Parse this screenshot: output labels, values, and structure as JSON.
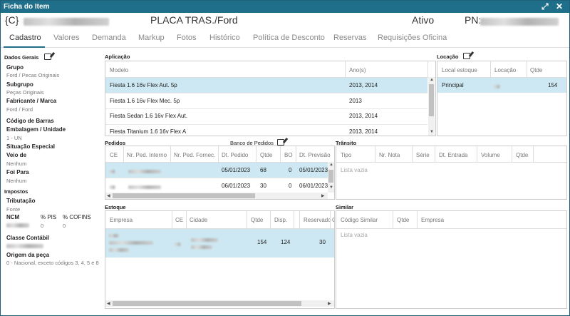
{
  "window": {
    "title": "Ficha do Item",
    "expand_icon": "expand-icon",
    "close_icon": "close-icon"
  },
  "header": {
    "code": "{C}",
    "description": "PLACA TRAS./Ford",
    "status": "Ativo",
    "pn_label": "PN:"
  },
  "tabs": [
    "Cadastro",
    "Valores",
    "Demanda",
    "Markup",
    "Fotos",
    "Histórico",
    "Política de Desconto",
    "Reservas",
    "Requisições Oficina"
  ],
  "side": {
    "title": "Dados Gerais",
    "grupo_label": "Grupo",
    "grupo_value": "Ford / Pecas Originais",
    "subgrupo_label": "Subgrupo",
    "subgrupo_value": "Peças Originais",
    "fabricante_label": "Fabricante / Marca",
    "fabricante_value": "Ford /  Ford",
    "codbarras_label": "Código de Barras",
    "embalagem_label": "Embalagem / Unidade",
    "embalagem_value": "1 - UN",
    "situacao_label": "Situação Especial",
    "veio_label": "Veio de",
    "veio_value": "Nenhum",
    "foi_label": "Foi Para",
    "foi_value": "Nenhum",
    "impostos_title": "Impostos",
    "tributacao_label": "Tributação",
    "tributacao_value": "Fonte",
    "ncm_label": "NCM",
    "pis_label": "% PIS",
    "cofins_label": "% COFINS",
    "pis_value": "0",
    "cofins_value": "0",
    "classe_label": "Classe Contábil",
    "origem_label": "Origem da peça",
    "origem_value": "0 - Nacional, exceto códigos 3, 4, 5 e 8"
  },
  "aplicacao": {
    "title": "Aplicação",
    "columns": [
      "Modelo",
      "Ano(s)"
    ],
    "rows": [
      [
        "Fiesta 1.6 16v Flex Aut. 5p",
        "2013, 2014"
      ],
      [
        "Fiesta 1.6 16v Flex Mec. 5p",
        "2013"
      ],
      [
        "Fiesta Sedan 1.6 16v Flex Aut.",
        "2013, 2014"
      ],
      [
        "Fiesta Titanium 1.6 16v Flex A",
        "2013, 2014"
      ]
    ]
  },
  "locacao": {
    "title": "Locação",
    "columns": [
      "Local estoque",
      "Locação",
      "Qtde"
    ],
    "rows": [
      [
        "Principal",
        "",
        "154"
      ]
    ]
  },
  "pedidos": {
    "title": "Pedidos",
    "banco_label": "Banco de Pedidos",
    "columns": [
      "CE",
      "Nr. Ped. Interno",
      "Nr. Ped. Fornec.",
      "Dt. Pedido",
      "Qtde",
      "BO",
      "Dt. Previsão"
    ],
    "rows": [
      [
        "",
        "",
        "",
        "05/01/2023",
        "68",
        "0",
        "05/01/2023"
      ],
      [
        "",
        "",
        "",
        "06/01/2023",
        "30",
        "0",
        "06/01/2023"
      ]
    ]
  },
  "transito": {
    "title": "Trânsito",
    "columns": [
      "Tipo",
      "Nr. Nota",
      "Série",
      "Dt. Entrada",
      "Volume",
      "Qtde"
    ],
    "empty": "Lista vazia"
  },
  "estoque": {
    "title": "Estoque",
    "columns": [
      "Empresa",
      "CE",
      "Cidade",
      "Qtde",
      "Disp.",
      "Reservado",
      "C"
    ],
    "rows": [
      [
        "",
        "",
        "",
        "154",
        "124",
        "",
        "30"
      ]
    ]
  },
  "similar": {
    "title": "Similar",
    "columns": [
      "Código Similar",
      "Qtde",
      "Empresa"
    ],
    "empty": "Lista vazia"
  }
}
